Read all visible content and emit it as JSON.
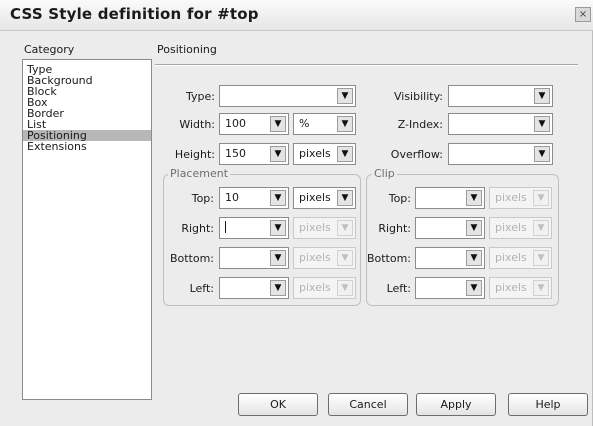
{
  "window": {
    "title": "CSS Style definition for #top",
    "close_glyph": "×"
  },
  "category": {
    "header": "Category",
    "items": [
      "Type",
      "Background",
      "Block",
      "Box",
      "Border",
      "List",
      "Positioning",
      "Extensions"
    ],
    "selected": "Positioning"
  },
  "panel": {
    "title": "Positioning"
  },
  "fields": {
    "type": {
      "label": "Type:",
      "value": ""
    },
    "width": {
      "label": "Width:",
      "value": "100",
      "unit": "%"
    },
    "height": {
      "label": "Height:",
      "value": "150",
      "unit": "pixels"
    },
    "visibility": {
      "label": "Visibility:",
      "value": ""
    },
    "zindex": {
      "label": "Z-Index:",
      "value": ""
    },
    "overflow": {
      "label": "Overflow:",
      "value": ""
    }
  },
  "placement": {
    "legend": "Placement",
    "top": {
      "label": "Top:",
      "value": "10",
      "unit": "pixels"
    },
    "right": {
      "label": "Right:",
      "value": "",
      "unit": "pixels"
    },
    "bottom": {
      "label": "Bottom:",
      "value": "",
      "unit": "pixels"
    },
    "left": {
      "label": "Left:",
      "value": "",
      "unit": "pixels"
    }
  },
  "clip": {
    "legend": "Clip",
    "top": {
      "label": "Top:",
      "value": "",
      "unit": "pixels"
    },
    "right": {
      "label": "Right:",
      "value": "",
      "unit": "pixels"
    },
    "bottom": {
      "label": "Bottom:",
      "value": "",
      "unit": "pixels"
    },
    "left": {
      "label": "Left:",
      "value": "",
      "unit": "pixels"
    }
  },
  "buttons": {
    "ok": "OK",
    "cancel": "Cancel",
    "apply": "Apply",
    "help": "Help"
  },
  "icons": {
    "dropdown": "▼"
  },
  "colors": {
    "selected_bg": "#b7b7b7",
    "dialog_bg": "#ececec"
  }
}
